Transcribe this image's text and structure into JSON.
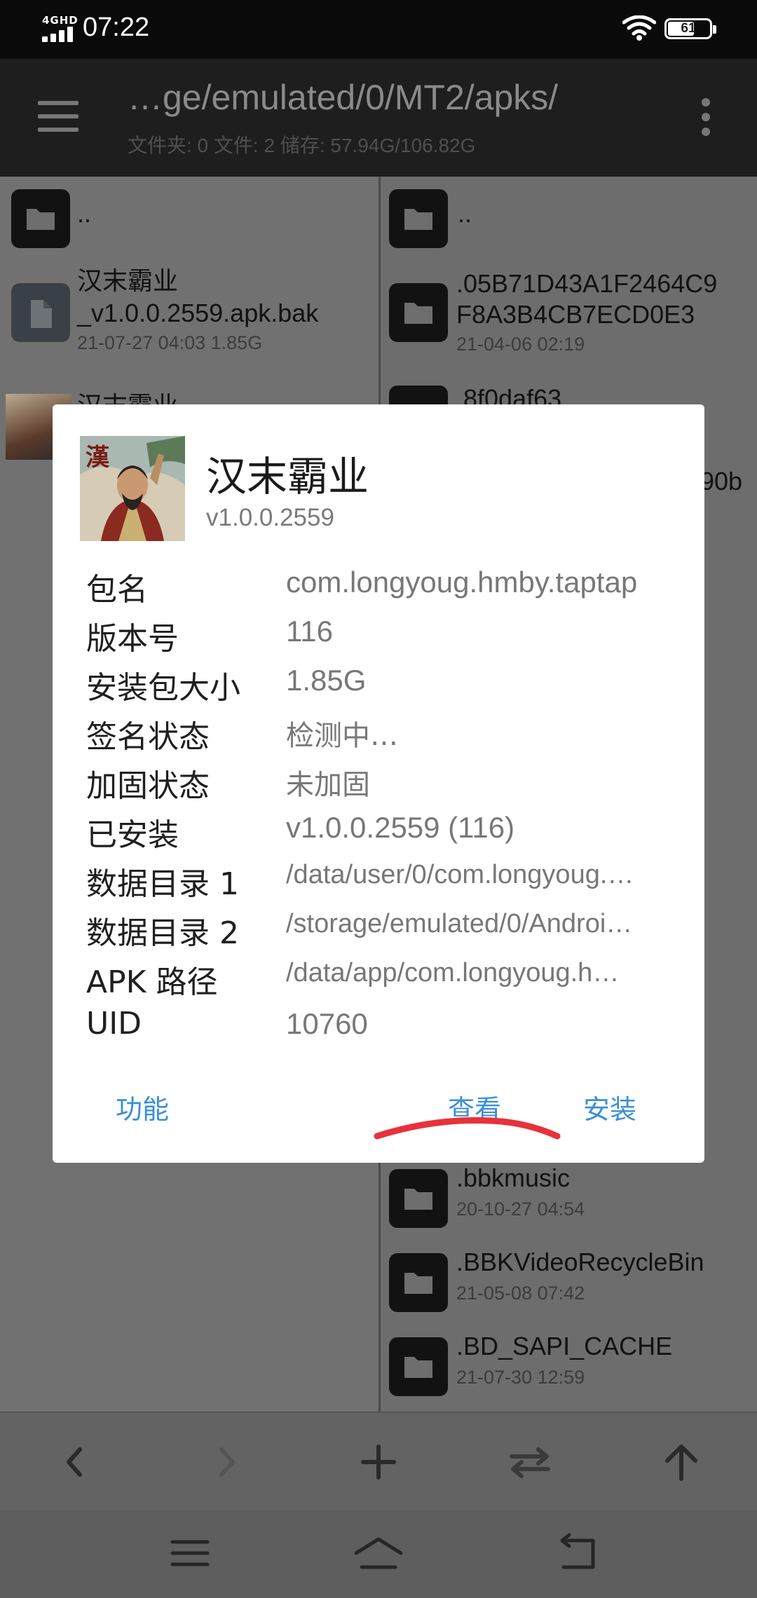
{
  "status_bar": {
    "network": "4GHD",
    "time": "07:22",
    "battery": "61"
  },
  "toolbar": {
    "path": "…ge/emulated/0/MT2/apks/",
    "info": "文件夹: 0  文件: 2  储存: 57.94G/106.82G"
  },
  "left_pane": {
    "parent": "..",
    "file1_name_line1": "汉末霸业",
    "file1_name_line2": "_v1.0.0.2559.apk.bak",
    "file1_meta": "21-07-27 04:03  1.85G",
    "file2_name": "汉末霸业"
  },
  "right_pane": {
    "parent": "..",
    "items": [
      {
        "name_line1": ".05B71D43A1F2464C9",
        "name_line2": "F8A3B4CB7ECD0E3",
        "meta": "21-04-06 02:19"
      },
      {
        "name": ".8f0daf63"
      },
      {
        "name_fragment": "90b"
      },
      {
        "name": ".bbkmusic",
        "meta": "20-10-27 04:54"
      },
      {
        "name": ".BBKVideoRecycleBin",
        "meta": "21-05-08 07:42"
      },
      {
        "name": ".BD_SAPI_CACHE",
        "meta": "21-07-30 12:59"
      }
    ]
  },
  "dialog": {
    "app_name": "汉末霸业",
    "version": "v1.0.0.2559",
    "rows": [
      {
        "label": "包名",
        "value": "com.longyoug.hmby.taptap"
      },
      {
        "label": "版本号",
        "value": "116"
      },
      {
        "label": "安装包大小",
        "value": "1.85G"
      },
      {
        "label": "签名状态",
        "value": "检测中…"
      },
      {
        "label": "加固状态",
        "value": "未加固"
      },
      {
        "label": "已安装",
        "value": "v1.0.0.2559 (116)"
      },
      {
        "label": "数据目录 1",
        "value": "/data/user/0/com.longyoug.…"
      },
      {
        "label": "数据目录 2",
        "value": "/storage/emulated/0/Androi…"
      },
      {
        "label": "APK 路径",
        "value": "/data/app/com.longyoug.h…"
      },
      {
        "label": "UID",
        "value": "10760"
      }
    ],
    "buttons": {
      "functions": "功能",
      "view": "查看",
      "install": "安装"
    },
    "accent_color": "#3a8fd6",
    "annotation_color": "#e8313a"
  },
  "icons": {
    "back": "chevron-left-icon",
    "forward": "chevron-right-icon",
    "add": "plus-icon",
    "swap": "swap-icon",
    "up": "arrow-up-icon",
    "nav_menu": "menu-icon",
    "nav_home": "home-icon",
    "nav_back": "back-icon"
  }
}
